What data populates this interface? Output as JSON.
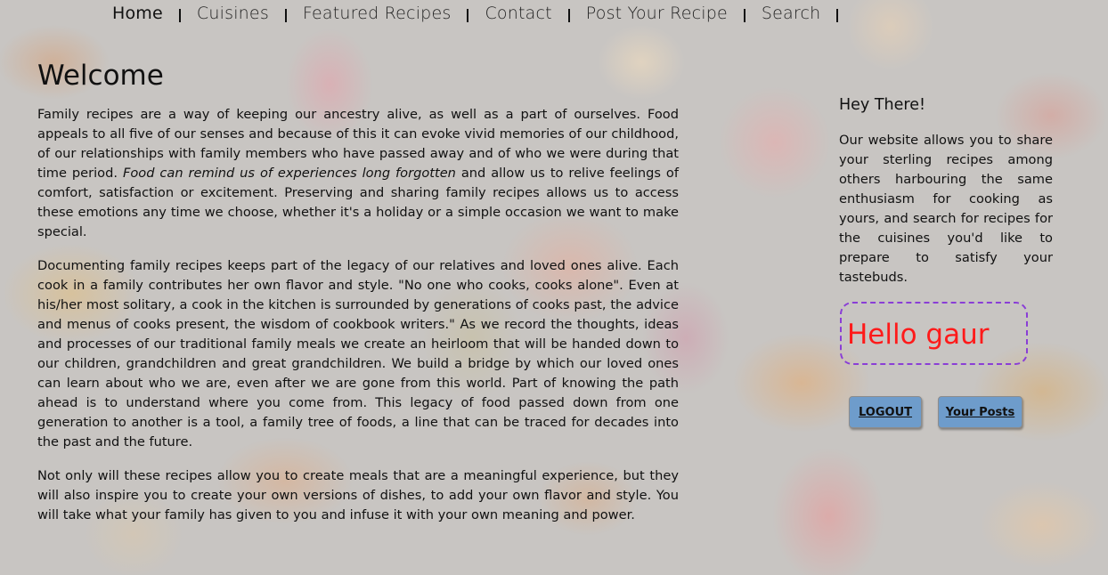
{
  "nav": {
    "items": [
      "Home",
      "Cuisines",
      "Featured Recipes",
      "Contact",
      "Post Your Recipe",
      "Search"
    ],
    "active": "Home"
  },
  "main": {
    "title": "Welcome",
    "p1_before_em": "Family recipes are a way of keeping our ancestry alive, as well as a part of ourselves. Food appeals to all five of our senses and because of this it can evoke vivid memories of our childhood, of our relationships with family members who have passed away and of who we were during that time period. ",
    "p1_em": "Food can remind us of experiences long forgotten",
    "p1_after_em": " and allow us to relive feelings of comfort, satisfaction or excitement. Preserving and sharing family recipes allows us to access these emotions any time we choose, whether it's a holiday or a simple occasion we want to make special.",
    "p2": "Documenting family recipes keeps part of the legacy of our relatives and loved ones alive. Each cook in a family contributes her own flavor and style. \"No one who cooks, cooks alone\". Even at his/her most solitary, a cook in the kitchen is surrounded by generations of cooks past, the advice and menus of cooks present, the wisdom of cookbook writers.\" As we record the thoughts, ideas and processes of our traditional family meals we create an heirloom that will be handed down to our children, grandchildren and great grandchildren. We build a bridge by which our loved ones can learn about who we are, even after we are gone from this world. Part of knowing the path ahead is to understand where you come from. This legacy of food passed down from one generation to another is a tool, a family tree of foods, a line that can be traced for decades into the past and the future.",
    "p3": "Not only will these recipes allow you to create meals that are a meaningful experience, but they will also inspire you to create your own versions of dishes, to add your own flavor and style. You will take what your family has given to you and infuse it with your own meaning and power."
  },
  "sidebar": {
    "heading": "Hey There!",
    "text": "Our website allows you to share your sterling recipes among others harbouring the same enthusiasm for cooking as yours, and search for recipes for the cuisines you'd like to prepare to satisfy your tastebuds.",
    "greeting": "Hello gaur",
    "logout_label": "LOGOUT",
    "posts_label": "Your Posts"
  },
  "colors": {
    "greeting_text": "#ff1a1a",
    "greeting_border": "#8a3ed6",
    "button_bg": "#6e9ccb"
  }
}
